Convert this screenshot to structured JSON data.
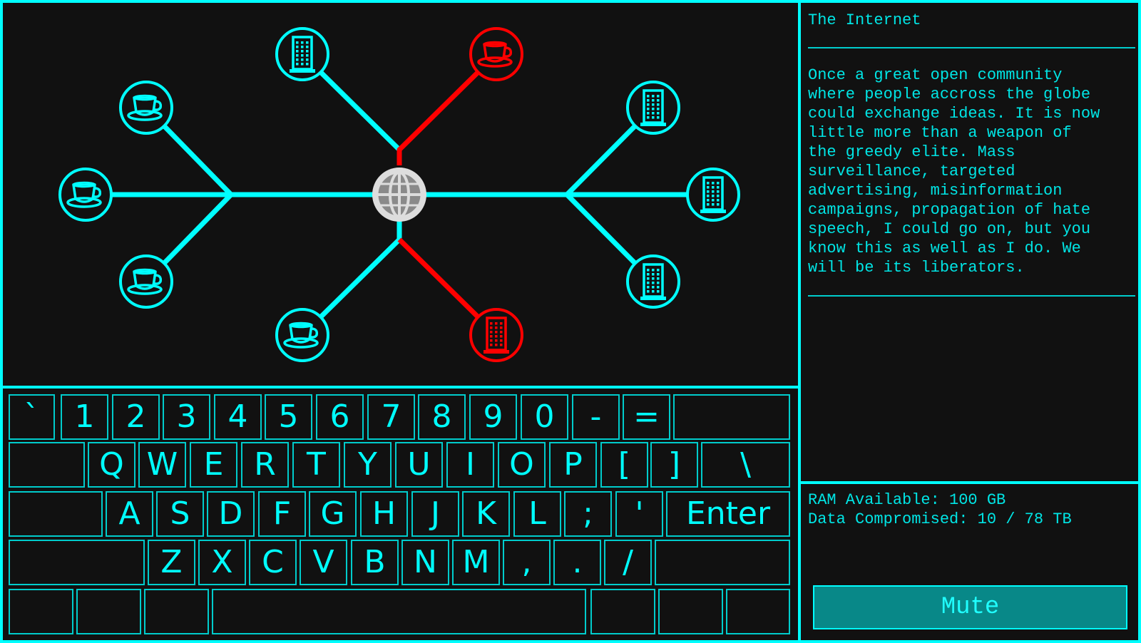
{
  "colors": {
    "accent": "#00ffff",
    "danger": "#ff0000",
    "hub": "#dddddd",
    "background": "#111111"
  },
  "network": {
    "hub_icon": "globe-icon",
    "nodes": [
      {
        "id": "building-top",
        "icon": "office-building-icon",
        "compromised": false
      },
      {
        "id": "cafe-top",
        "icon": "coffee-cup-icon",
        "compromised": true
      },
      {
        "id": "cafe-upper-left",
        "icon": "coffee-cup-icon",
        "compromised": false
      },
      {
        "id": "cafe-left",
        "icon": "coffee-cup-icon",
        "compromised": false
      },
      {
        "id": "cafe-lower-left",
        "icon": "coffee-cup-icon",
        "compromised": false
      },
      {
        "id": "cafe-bottom",
        "icon": "coffee-cup-icon",
        "compromised": false
      },
      {
        "id": "building-bottom",
        "icon": "office-building-icon",
        "compromised": true
      },
      {
        "id": "building-upper-right",
        "icon": "office-building-icon",
        "compromised": false
      },
      {
        "id": "building-right",
        "icon": "office-building-icon",
        "compromised": false
      },
      {
        "id": "building-lower-right",
        "icon": "office-building-icon",
        "compromised": false
      }
    ]
  },
  "info": {
    "title": "The Internet",
    "body": "Once a great open community\nwhere people accross the globe\ncould exchange ideas. It is now\nlittle more than a weapon of\nthe greedy elite. Mass\nsurveillance, targeted\nadvertising, misinformation\ncampaigns, propagation of hate\nspeech, I could go on, but you\nknow this as well as I do. We\nwill be its liberators."
  },
  "stats": {
    "ram": "RAM Available: 100 GB",
    "data": "Data Compromised: 10 / 78 TB",
    "mute_label": "Mute"
  },
  "keyboard": {
    "rows": [
      [
        "`",
        "1",
        "2",
        "3",
        "4",
        "5",
        "6",
        "7",
        "8",
        "9",
        "0",
        "-",
        "=",
        ""
      ],
      [
        "",
        "Q",
        "W",
        "E",
        "R",
        "T",
        "Y",
        "U",
        "I",
        "O",
        "P",
        "[",
        "]",
        "\\"
      ],
      [
        "",
        "A",
        "S",
        "D",
        "F",
        "G",
        "H",
        "J",
        "K",
        "L",
        ";",
        "'",
        "Enter"
      ],
      [
        "",
        "Z",
        "X",
        "C",
        "V",
        "B",
        "N",
        "M",
        ",",
        ".",
        "/",
        ""
      ],
      [
        "",
        "",
        "",
        "",
        "",
        "",
        "",
        ""
      ]
    ]
  }
}
